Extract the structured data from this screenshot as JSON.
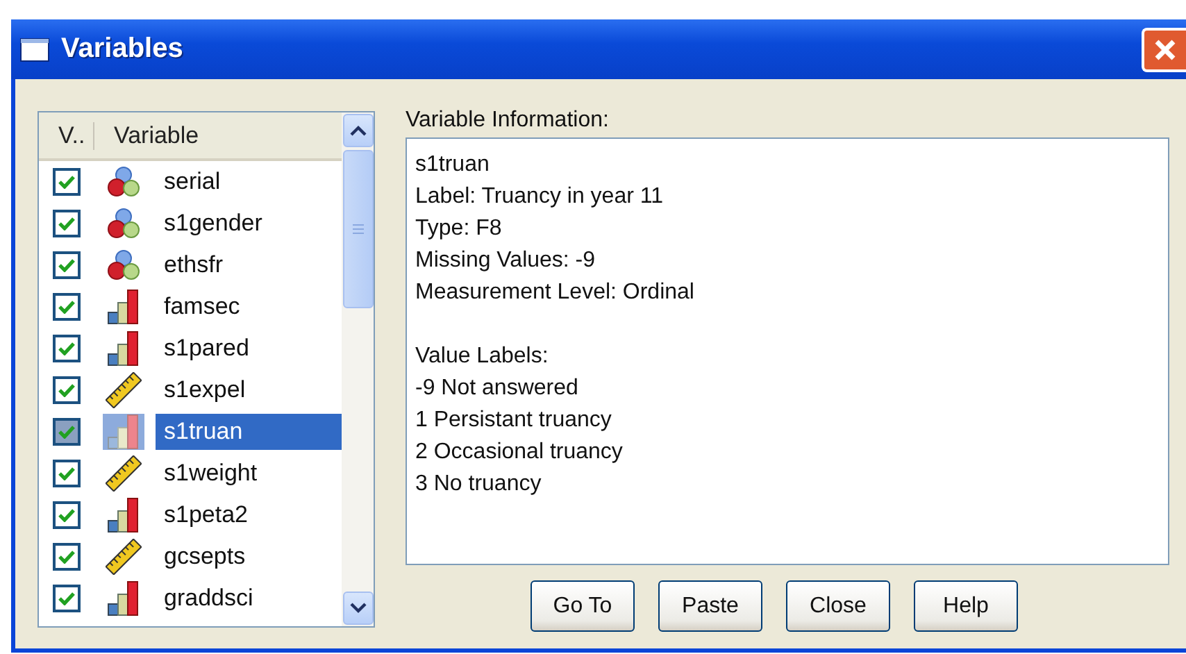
{
  "window": {
    "title": "Variables"
  },
  "variable_list": {
    "columns": [
      "V..",
      "Variable"
    ],
    "rows": [
      {
        "name": "serial",
        "kind": "nominal",
        "checked": true,
        "selected": false
      },
      {
        "name": "s1gender",
        "kind": "nominal",
        "checked": true,
        "selected": false
      },
      {
        "name": "ethsfr",
        "kind": "nominal",
        "checked": true,
        "selected": false
      },
      {
        "name": "famsec",
        "kind": "ordinal",
        "checked": true,
        "selected": false
      },
      {
        "name": "s1pared",
        "kind": "ordinal",
        "checked": true,
        "selected": false
      },
      {
        "name": "s1expel",
        "kind": "scale",
        "checked": true,
        "selected": false
      },
      {
        "name": "s1truan",
        "kind": "ordinal",
        "checked": true,
        "selected": true
      },
      {
        "name": "s1weight",
        "kind": "scale",
        "checked": true,
        "selected": false
      },
      {
        "name": "s1peta2",
        "kind": "ordinal",
        "checked": true,
        "selected": false
      },
      {
        "name": "gcsepts",
        "kind": "scale",
        "checked": true,
        "selected": false
      },
      {
        "name": "graddsci",
        "kind": "ordinal",
        "checked": true,
        "selected": false
      }
    ]
  },
  "info": {
    "label": "Variable Information:",
    "details": [
      "s1truan",
      "Label:  Truancy in year 11",
      "Type:  F8",
      "Missing Values:  -9",
      "Measurement Level:  Ordinal"
    ],
    "value_labels_heading": "Value Labels:",
    "value_labels": [
      "-9 Not answered",
      "1 Persistant truancy",
      "2 Occasional truancy",
      "3 No truancy"
    ]
  },
  "buttons": [
    "Go To",
    "Paste",
    "Close",
    "Help"
  ]
}
